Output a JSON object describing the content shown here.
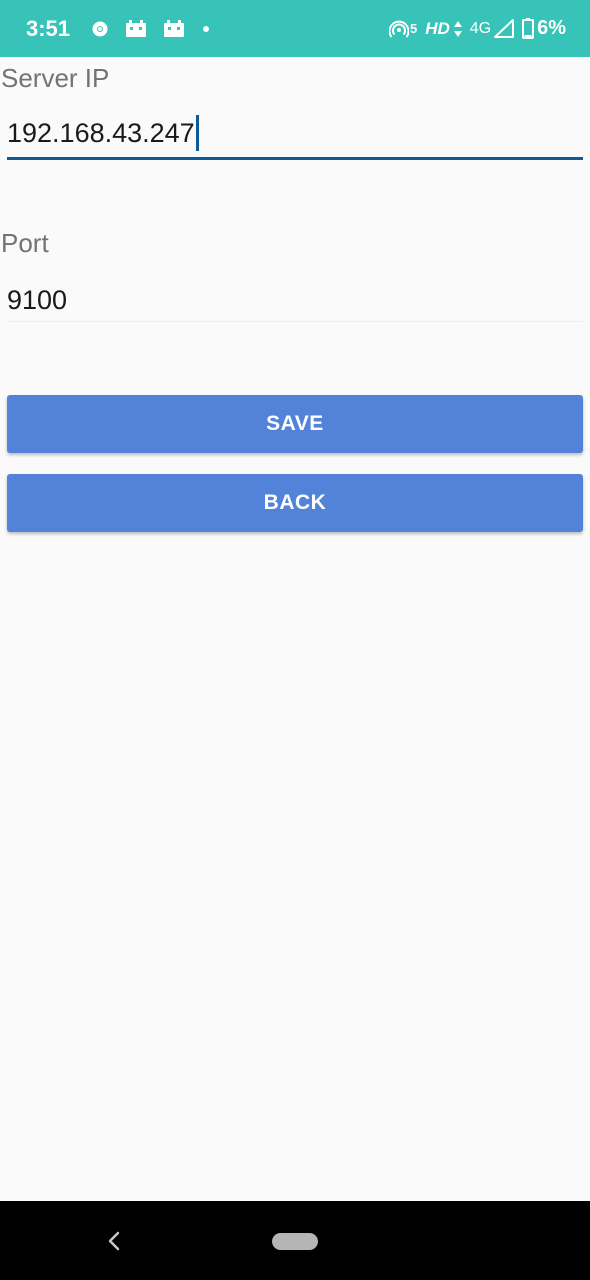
{
  "status_bar": {
    "time": "3:51",
    "hotspot_count": "5",
    "hd": "HD",
    "network": "4G",
    "battery": "6%",
    "background_color": "#37c3b8",
    "left_icons": [
      "chrome-icon",
      "photo-icon",
      "photo-icon",
      "dot-icon"
    ],
    "right_icons": [
      "hotspot-icon",
      "data-arrows-icon",
      "signal-icon",
      "battery-icon"
    ]
  },
  "form": {
    "server_ip": {
      "label": "Server IP",
      "value": "192.168.43.247"
    },
    "port": {
      "label": "Port",
      "value": "9100"
    }
  },
  "buttons": {
    "save": "SAVE",
    "back": "BACK",
    "color": "#5283d9"
  },
  "nav_bar": {
    "icons": [
      "back-chevron-icon",
      "home-pill-icon"
    ]
  },
  "colors": {
    "accent": "#0d5a9a",
    "background": "#fafafa"
  }
}
